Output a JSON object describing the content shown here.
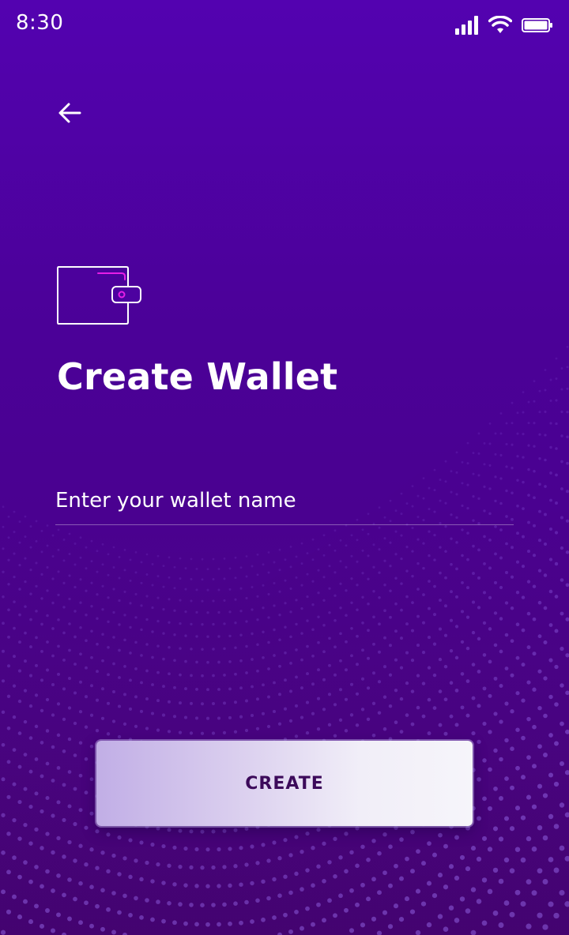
{
  "status_bar": {
    "time": "8:30",
    "icons": [
      "signal-icon",
      "wifi-icon",
      "battery-icon"
    ]
  },
  "header": {
    "back_icon": "arrow-left-icon"
  },
  "main": {
    "icon": "wallet-icon",
    "title": "Create Wallet",
    "wallet_name_input": {
      "value": "",
      "placeholder": "Enter your wallet name"
    },
    "create_label": "CREATE"
  },
  "colors": {
    "background_top": "#5302b0",
    "background_bottom": "#470470",
    "wallet_accent": "#e61ee6",
    "button_text": "#3c0a5a"
  }
}
